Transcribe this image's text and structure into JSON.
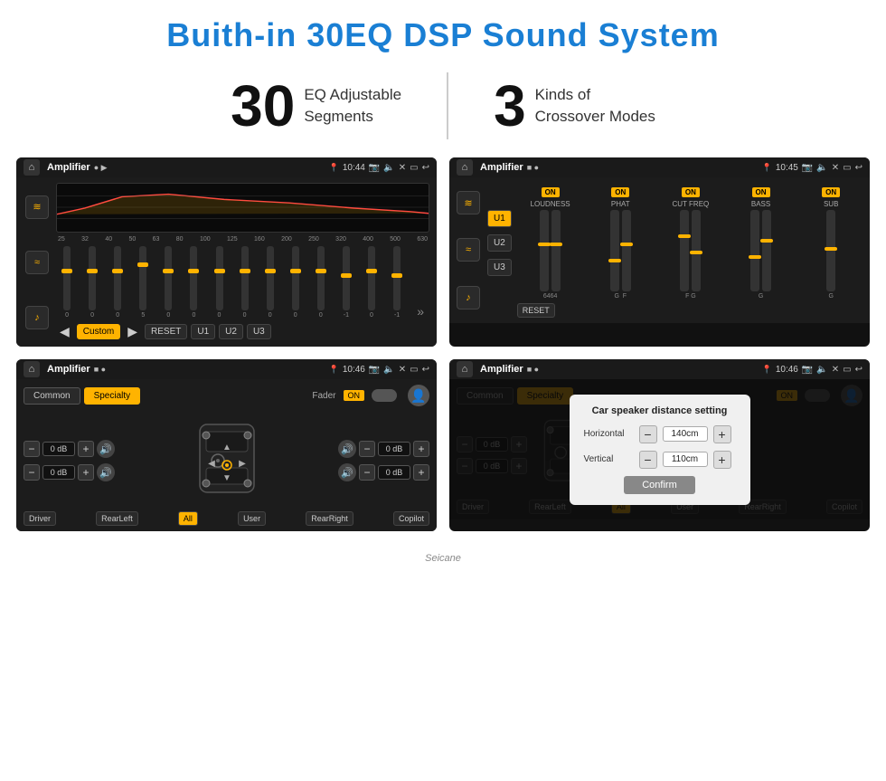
{
  "header": {
    "title": "Buith-in 30EQ DSP Sound System"
  },
  "stats": [
    {
      "number": "30",
      "text_line1": "EQ Adjustable",
      "text_line2": "Segments"
    },
    {
      "number": "3",
      "text_line1": "Kinds of",
      "text_line2": "Crossover Modes"
    }
  ],
  "screens": [
    {
      "id": "screen1",
      "status_bar": {
        "app": "Amplifier",
        "time": "10:44"
      },
      "eq_labels": [
        "25",
        "32",
        "40",
        "50",
        "63",
        "80",
        "100",
        "125",
        "160",
        "200",
        "250",
        "320",
        "400",
        "500",
        "630"
      ],
      "sliders": [
        {
          "val": "0",
          "pos": 50
        },
        {
          "val": "0",
          "pos": 50
        },
        {
          "val": "0",
          "pos": 50
        },
        {
          "val": "5",
          "pos": 40
        },
        {
          "val": "0",
          "pos": 50
        },
        {
          "val": "0",
          "pos": 50
        },
        {
          "val": "0",
          "pos": 50
        },
        {
          "val": "0",
          "pos": 50
        },
        {
          "val": "0",
          "pos": 50
        },
        {
          "val": "0",
          "pos": 50
        },
        {
          "val": "0",
          "pos": 50
        },
        {
          "val": "-1",
          "pos": 55
        },
        {
          "val": "0",
          "pos": 50
        },
        {
          "val": "-1",
          "pos": 55
        }
      ],
      "bottom_buttons": [
        "Custom",
        "RESET",
        "U1",
        "U2",
        "U3"
      ]
    },
    {
      "id": "screen2",
      "status_bar": {
        "app": "Amplifier",
        "time": "10:45"
      },
      "u_buttons": [
        "U1",
        "U2",
        "U3"
      ],
      "columns": [
        {
          "label": "LOUDNESS",
          "on": true
        },
        {
          "label": "PHAT",
          "on": true
        },
        {
          "label": "CUT FREQ",
          "on": true
        },
        {
          "label": "BASS",
          "on": true
        },
        {
          "label": "SUB",
          "on": true
        }
      ],
      "reset_label": "RESET"
    },
    {
      "id": "screen3",
      "status_bar": {
        "app": "Amplifier",
        "time": "10:46"
      },
      "tabs": [
        "Common",
        "Specialty"
      ],
      "fader_label": "Fader",
      "fader_on": "ON",
      "db_values": [
        "0 dB",
        "0 dB",
        "0 dB",
        "0 dB"
      ],
      "speaker_labels": [
        "Driver",
        "RearLeft",
        "All",
        "User",
        "RearRight",
        "Copilot"
      ]
    },
    {
      "id": "screen4",
      "status_bar": {
        "app": "Amplifier",
        "time": "10:46"
      },
      "tabs": [
        "Common",
        "Specialty"
      ],
      "dialog": {
        "title": "Car speaker distance setting",
        "horizontal_label": "Horizontal",
        "horizontal_value": "140cm",
        "vertical_label": "Vertical",
        "vertical_value": "110cm",
        "confirm_label": "Confirm"
      },
      "db_values_right": [
        "0 dB",
        "0 dB"
      ],
      "speaker_labels": [
        "Driver",
        "RearLeft",
        "User",
        "RearRight",
        "Copilot"
      ]
    }
  ],
  "footer": {
    "logo": "Seicane"
  },
  "icons": {
    "home": "⌂",
    "settings": "≡",
    "back": "↩",
    "play": "▶",
    "pause": "⏸",
    "prev": "◀",
    "next": "▶",
    "volume": "♪",
    "wifi": "((()))",
    "close": "✕",
    "expand": "»",
    "minus": "−",
    "plus": "+"
  }
}
